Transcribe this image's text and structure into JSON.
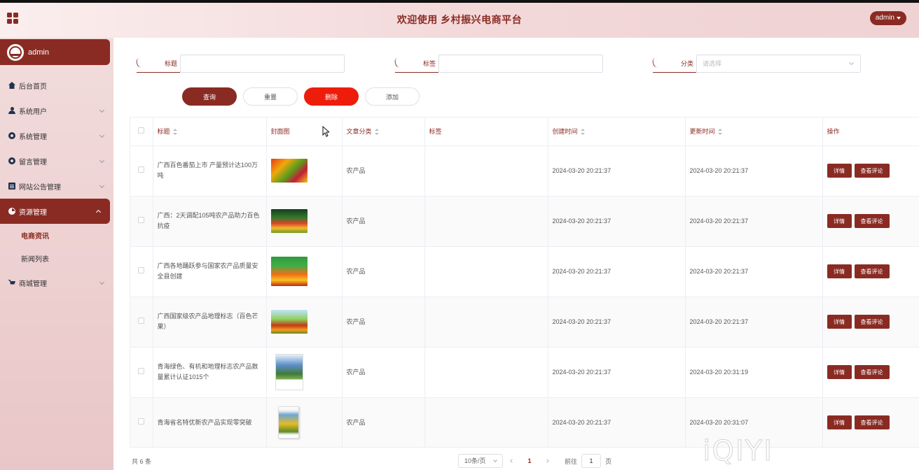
{
  "header": {
    "title": "欢迎使用 乡村振兴电商平台",
    "user_button": "admin"
  },
  "sidebar": {
    "user_name": "admin",
    "items": [
      {
        "label": "后台首页",
        "icon": "home-icon",
        "has_children": false
      },
      {
        "label": "系统用户",
        "icon": "user-icon",
        "has_children": true
      },
      {
        "label": "系统管理",
        "icon": "gear-icon",
        "has_children": true
      },
      {
        "label": "留言管理",
        "icon": "gear-icon",
        "has_children": true
      },
      {
        "label": "网站公告管理",
        "icon": "doc-icon",
        "has_children": true
      },
      {
        "label": "资源管理",
        "icon": "pie-chart-icon",
        "has_children": true,
        "expanded": true
      },
      {
        "label": "商城管理",
        "icon": "cart-icon",
        "has_children": true
      }
    ],
    "sub_items": [
      "电商资讯",
      "新闻列表"
    ]
  },
  "filters": {
    "title_label": "标题",
    "title_value": "",
    "tag_label": "标签",
    "tag_value": "",
    "category_label": "分类",
    "category_placeholder": "请选择"
  },
  "buttons": {
    "query": "查询",
    "reset": "重置",
    "delete": "删除",
    "add": "添加"
  },
  "table": {
    "headers": {
      "title": "标题",
      "cover": "封面图",
      "category": "文章分类",
      "tags": "标签",
      "created": "创建时间",
      "updated": "更新时间",
      "actions": "操作"
    },
    "action_labels": {
      "detail": "详情",
      "comments": "查看评论"
    },
    "rows": [
      {
        "title": "广西百色番茄上市 产量预计达100万吨",
        "category": "农产品",
        "tags": "",
        "created": "2024-03-20 20:21:37",
        "updated": "2024-03-20 20:21:37"
      },
      {
        "title": "广西：2天调配105吨农产品助力百色抗疫",
        "category": "农产品",
        "tags": "",
        "created": "2024-03-20 20:21:37",
        "updated": "2024-03-20 20:21:37"
      },
      {
        "title": "广西各地踊跃参与国家农产品质量安全县创建",
        "category": "农产品",
        "tags": "",
        "created": "2024-03-20 20:21:37",
        "updated": "2024-03-20 20:21:37"
      },
      {
        "title": "广西国家级农产品地理标志（百色芒果）",
        "category": "农产品",
        "tags": "",
        "created": "2024-03-20 20:21:37",
        "updated": "2024-03-20 20:21:37"
      },
      {
        "title": "青海绿色、有机和地理标志农产品数量累计认证1015个",
        "category": "农产品",
        "tags": "",
        "created": "2024-03-20 20:21:37",
        "updated": "2024-03-20 20:31:19"
      },
      {
        "title": "青海省名特优新农产品实现零突破",
        "category": "农产品",
        "tags": "",
        "created": "2024-03-20 20:21:37",
        "updated": "2024-03-20 20:31:07"
      }
    ]
  },
  "pagination": {
    "total_text": "共 6 条",
    "page_size": "10条/页",
    "current_page": "1",
    "goto_label": "前往",
    "goto_value": "1",
    "page_suffix": "页"
  },
  "watermark": "iQIYI",
  "colors": {
    "brand": "#8a2b23",
    "danger": "#ee1d0b"
  }
}
